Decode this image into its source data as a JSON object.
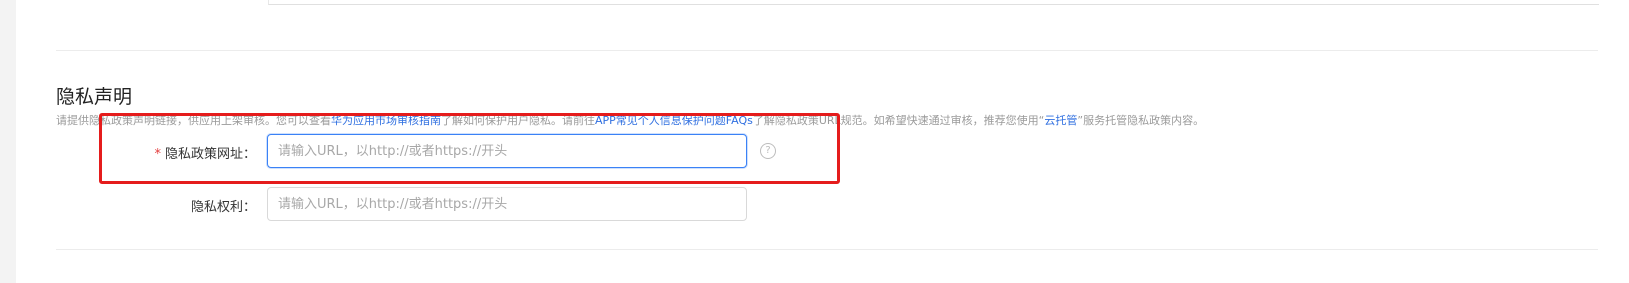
{
  "privacy_section": {
    "title": "隐私声明",
    "desc_part1": "请提供隐私政策声明链接，供应用上架审核。您可以查看",
    "link_guide": "华为应用市场审核指南",
    "desc_part2": "了解如何保护用户隐私。请前往",
    "link_faq": "APP常见个人信息保护问题FAQs",
    "desc_part3": "了解隐私政策URL规范。如希望快速通过审核，推荐您使用“",
    "link_cloud": "云托管",
    "desc_part4": "”服务托管隐私政策内容。"
  },
  "privacy_policy_url": {
    "required_mark": "*",
    "label": "隐私政策网址：",
    "placeholder": "请输入URL，以http://或者https://开头",
    "value": "",
    "help_glyph": "?"
  },
  "privacy_rights": {
    "label": "隐私权利：",
    "placeholder": "请输入URL，以http://或者https://开头",
    "value": ""
  },
  "colors": {
    "highlight": "#e51c1c",
    "link": "#2f6fe0",
    "focus": "#3b82f6"
  }
}
